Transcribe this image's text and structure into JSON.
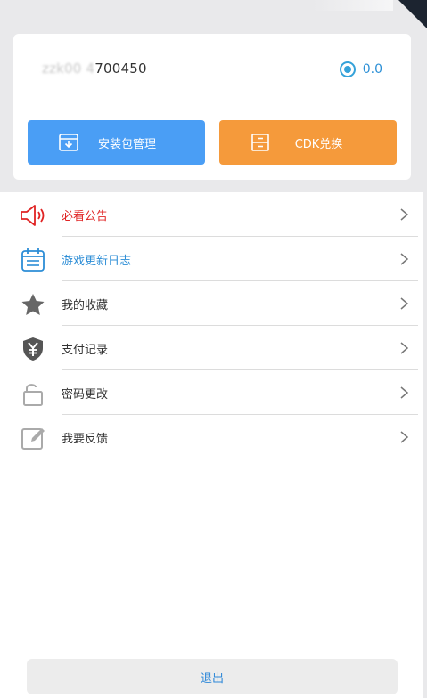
{
  "account": {
    "username_blurred": "zzk00 4",
    "username_visible": "700450",
    "balance": "0.0"
  },
  "actions": {
    "package_label": "安装包管理",
    "cdk_label": "CDK兑换"
  },
  "menu": [
    {
      "label": "必看公告",
      "color": "#e02424",
      "icon": "speaker-icon"
    },
    {
      "label": "游戏更新日志",
      "color": "#2c8dd6",
      "icon": "calendar-icon"
    },
    {
      "label": "我的收藏",
      "color": "#333333",
      "icon": "star-icon"
    },
    {
      "label": "支付记录",
      "color": "#333333",
      "icon": "yen-shield-icon"
    },
    {
      "label": "密码更改",
      "color": "#333333",
      "icon": "unlock-icon"
    },
    {
      "label": "我要反馈",
      "color": "#333333",
      "icon": "edit-icon"
    }
  ],
  "logout_label": "退出",
  "colors": {
    "blue_button": "#4a9ef5",
    "orange_button": "#f59a3b",
    "accent_blue": "#2c8dd6",
    "notice_red": "#e02424"
  }
}
